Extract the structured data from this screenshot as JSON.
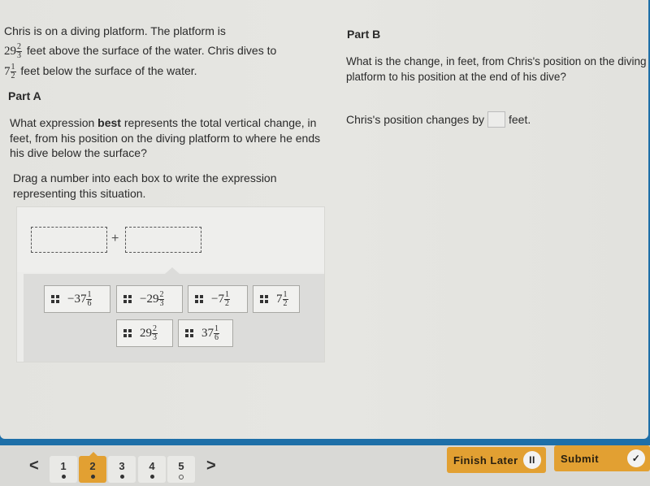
{
  "stem": {
    "line1": "Chris is on a diving platform. The platform is",
    "platform_height": {
      "whole": "29",
      "num": "2",
      "den": "3"
    },
    "line2_text": "feet above the surface of the water. Chris dives to",
    "dive_depth": {
      "whole": "7",
      "num": "1",
      "den": "2"
    },
    "line3_text": "feet below the surface of the water."
  },
  "part_a": {
    "heading": "Part A",
    "question_pre": "What expression ",
    "question_bold": "best",
    "question_post": " represents the total vertical change, in feet, from his position on the diving platform to where he ends his dive below the surface?",
    "instruction": "Drag a number into each box to write the expression representing this situation.",
    "operator": "+",
    "tiles": [
      {
        "sign": "−",
        "whole": "37",
        "num": "1",
        "den": "6"
      },
      {
        "sign": "−",
        "whole": "29",
        "num": "2",
        "den": "3"
      },
      {
        "sign": "−",
        "whole": "7",
        "num": "1",
        "den": "2"
      },
      {
        "sign": "",
        "whole": "7",
        "num": "1",
        "den": "2"
      },
      {
        "sign": "",
        "whole": "29",
        "num": "2",
        "den": "3"
      },
      {
        "sign": "",
        "whole": "37",
        "num": "1",
        "den": "6"
      }
    ]
  },
  "part_b": {
    "heading": "Part B",
    "question_line1": "What is the change, in feet, from Chris's position on the diving",
    "question_line2": "platform to his position at the end of his dive?",
    "answer_pre": "Chris's position changes by",
    "answer_value": "",
    "answer_post": "feet."
  },
  "navigation": {
    "prev": "<",
    "next": ">",
    "pages": [
      {
        "label": "1",
        "answered": true,
        "active": false
      },
      {
        "label": "2",
        "answered": true,
        "active": true
      },
      {
        "label": "3",
        "answered": true,
        "active": false
      },
      {
        "label": "4",
        "answered": true,
        "active": false
      },
      {
        "label": "5",
        "answered": false,
        "active": false
      }
    ]
  },
  "actions": {
    "finish_later": "Finish Later",
    "finish_icon": "II",
    "submit": "Submit",
    "submit_icon": "✓"
  },
  "colors": {
    "accent": "#e2a032",
    "frame": "#1e6fa8"
  }
}
